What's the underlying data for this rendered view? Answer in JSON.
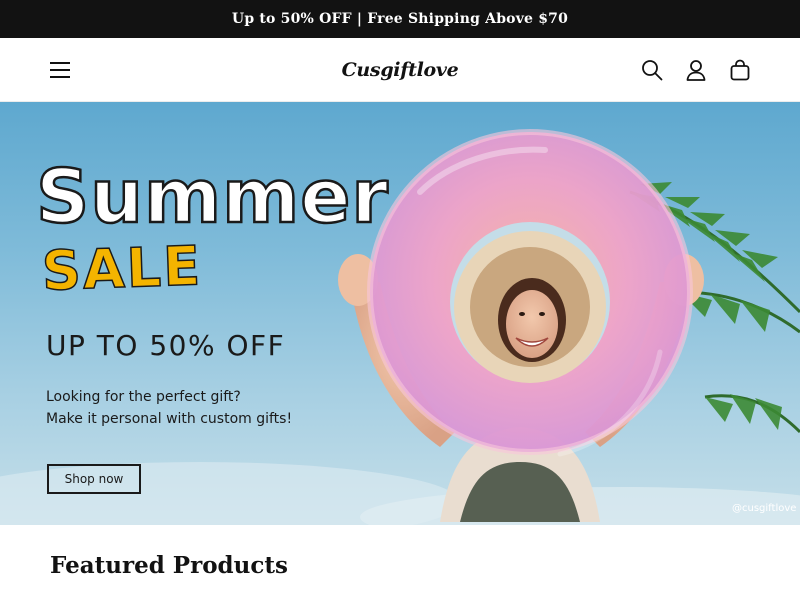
{
  "announcement": {
    "text": "Up to 50% OFF | Free Shipping Above $70"
  },
  "header": {
    "logo_text": "Cusgiftlove",
    "icons": [
      "hamburger-menu-icon",
      "search-icon",
      "account-icon",
      "cart-icon"
    ]
  },
  "hero": {
    "title": "Summer",
    "sale": "SALE",
    "discount": "UP TO 50% OFF",
    "subtitle_line1": "Looking for the perfect gift?",
    "subtitle_line2": "Make it personal with custom gifts!",
    "cta_label": "Shop now",
    "watermark": "@cusgiftlove"
  },
  "featured": {
    "heading": "Featured Products"
  },
  "colors": {
    "announcement_bg": "#121212",
    "sale_yellow": "#f4b400",
    "float_pink": "#f0a2c8",
    "sky_blue": "#7fbbd9"
  }
}
